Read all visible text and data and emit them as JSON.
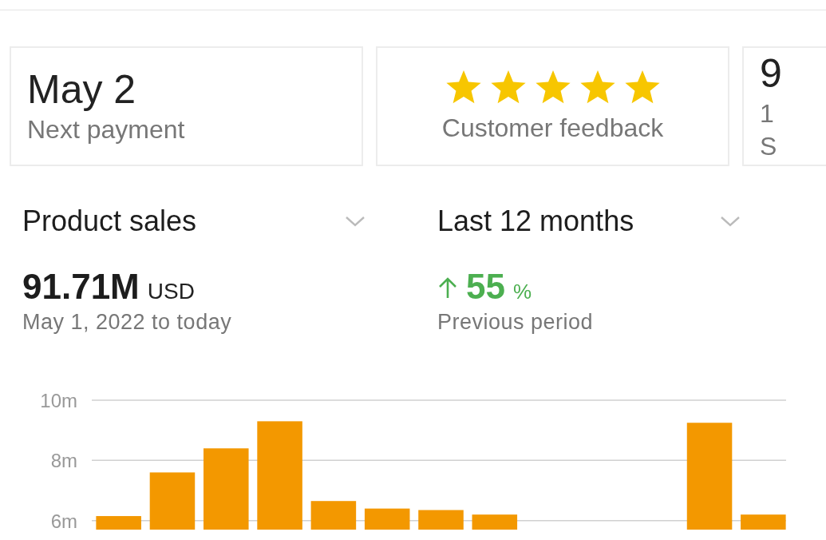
{
  "cards": [
    {
      "kind": "text",
      "title": "May 2",
      "subtitle": "Next payment"
    },
    {
      "kind": "stars",
      "stars": 5,
      "subtitle": "Customer feedback"
    },
    {
      "kind": "text",
      "title": "9",
      "subtitle": "1",
      "caption": "S"
    }
  ],
  "selectors": [
    {
      "label": "Product sales"
    },
    {
      "label": "Last 12 months"
    }
  ],
  "summary": {
    "amount": "91.71M",
    "currency": "USD",
    "range": "May 1, 2022 to today",
    "change": "55",
    "change_unit": "%",
    "comparison": "Previous period"
  },
  "chart_data": {
    "type": "bar",
    "ylim": [
      5.7,
      10
    ],
    "yticks": [
      {
        "value": 6,
        "label": "6m"
      },
      {
        "value": 8,
        "label": "8m"
      },
      {
        "value": 10,
        "label": "10m"
      }
    ],
    "values": [
      6.15,
      7.6,
      8.4,
      9.3,
      6.65,
      6.4,
      6.35,
      6.2,
      null,
      null,
      null,
      9.25,
      6.2
    ]
  }
}
